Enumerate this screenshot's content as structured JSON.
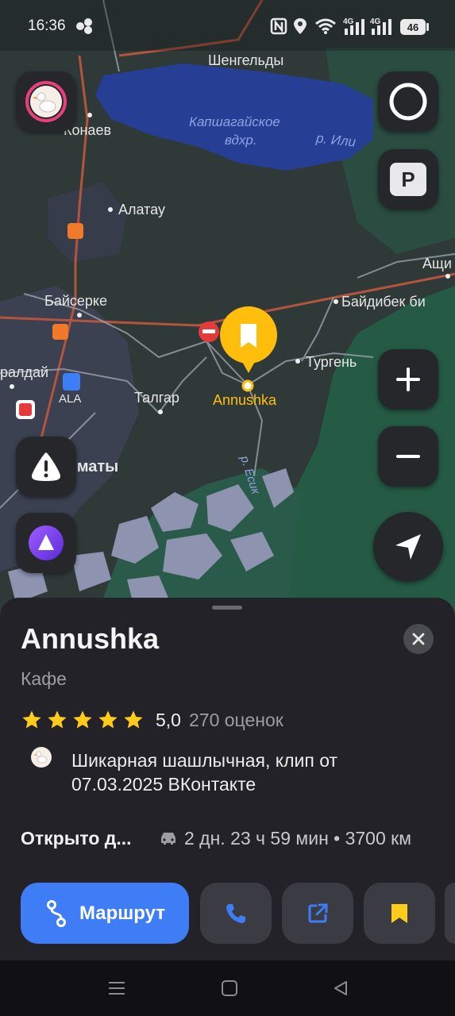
{
  "status_bar": {
    "time": "16:36",
    "battery": "46",
    "network_1": "4G",
    "network_2": "4G",
    "icons": [
      "nfc-icon",
      "location-icon",
      "wifi-icon",
      "signal-icon",
      "signal-icon",
      "battery-icon"
    ]
  },
  "map": {
    "labels": {
      "shengeldy": "Шенгельды",
      "konaev": "Конаев",
      "reservoir_line1": "Капшагайское",
      "reservoir_line2": "вдхр.",
      "river_ili": "р. Или",
      "alatau": "Алатау",
      "baiserke": "Байсерке",
      "baidibek": "Байдибек би",
      "ashi": "Ащи",
      "turgen": "Тургень",
      "ualdai": "ралдай",
      "ala": "ALA",
      "talgar": "Талгар",
      "almaty": "лматы",
      "river_esik": "р. Есик",
      "selected_place": "Annushka"
    },
    "colors": {
      "land": "#2f3a38",
      "water": "#263f94",
      "forest": "#255a45",
      "urban": "#3b4150",
      "pin": "#ffbe0b"
    },
    "buttons": {
      "avatar": "goose-icon",
      "alice_round": "ring-icon",
      "parking": "P",
      "zoom_in": "plus-icon",
      "zoom_out": "minus-icon",
      "incident": "warning-icon",
      "alice": "alice-icon",
      "locate": "navigation-arrow-icon"
    }
  },
  "place": {
    "title": "Annushka",
    "category": "Кафе",
    "rating": 5.0,
    "rating_text": "5,0",
    "stars": 5,
    "rating_count": "270 оценок",
    "clip_text": "Шикарная шашлычная, клип от 07.03.2025 ВКонтакте",
    "open_status": "Открыто д...",
    "route_time": "2 дн. 23 ч 59 мин • 3700 км"
  },
  "actions": {
    "route_label": "Маршрут",
    "call": "phone-icon",
    "share": "share-icon",
    "bookmark": "bookmark-icon"
  },
  "navbar": {
    "items": [
      "menu-icon",
      "home-icon",
      "back-icon"
    ]
  }
}
